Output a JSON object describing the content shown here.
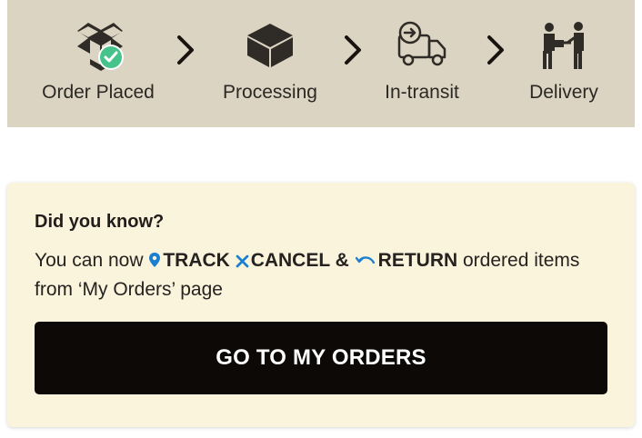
{
  "steps": [
    {
      "label": "Order Placed",
      "icon": "open-box-check-icon"
    },
    {
      "label": "Processing",
      "icon": "closed-box-icon"
    },
    {
      "label": "In-transit",
      "icon": "delivery-truck-icon"
    },
    {
      "label": "Delivery",
      "icon": "delivery-person-icon"
    }
  ],
  "separator_icon": "chevron-right-icon",
  "info": {
    "title": "Did you know?",
    "prefix": "You can now",
    "track": "TRACK",
    "cancel": "CANCEL &",
    "return": "RETURN",
    "suffix": "ordered items from ‘My Orders’ page"
  },
  "button": {
    "label": "GO TO MY ORDERS"
  },
  "colors": {
    "progress_background": "#dcd4c2",
    "card_background": "#fbf4dc",
    "button_background": "#0c0907",
    "accent_blue": "#1b7fd1",
    "success_green": "#45c38a",
    "text_dark": "#252220"
  }
}
